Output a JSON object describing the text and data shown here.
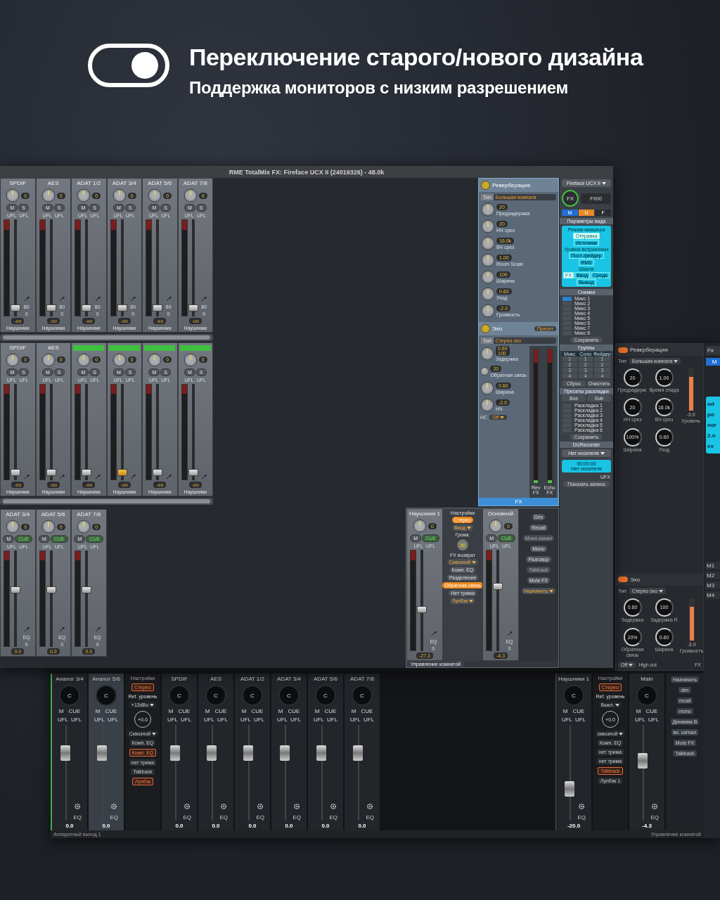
{
  "banner": {
    "switch_on": true,
    "title": "Переключение старого/нового дизайна",
    "subtitle": "Поддержка мониторов с низким разрешением"
  },
  "classic": {
    "title": "RME TotalMix FX: Fireface UCX II (24019326) - 48.0k",
    "rows": [
      {
        "strips": [
          {
            "name": "SPDIF",
            "gain": "0",
            "buttons": [
              "M",
              "S"
            ],
            "peaks": [
              "UFL",
              "UFL"
            ],
            "level": 0.05,
            "reading": "-oo",
            "route": "Наушники",
            "side": [
              "80",
              "0"
            ],
            "highlighted": false,
            "active": false
          },
          {
            "name": "AES",
            "gain": "0",
            "buttons": [
              "M",
              "S"
            ],
            "peaks": [
              "UFL",
              "UFL"
            ],
            "level": 0.05,
            "reading": "-oo",
            "route": "Наушники",
            "side": [
              "80",
              "0"
            ],
            "highlighted": false,
            "active": false
          },
          {
            "name": "ADAT 1/2",
            "gain": "0",
            "buttons": [
              "M",
              "S"
            ],
            "peaks": [
              "UFL",
              "UFL"
            ],
            "level": 0.05,
            "reading": "-oo",
            "route": "Наушники",
            "side": [
              "80",
              "0"
            ],
            "highlighted": false,
            "active": false
          },
          {
            "name": "ADAT 3/4",
            "gain": "0",
            "buttons": [
              "M",
              "S"
            ],
            "peaks": [
              "UFL",
              "UFL"
            ],
            "level": 0.05,
            "reading": "-oo",
            "route": "Наушники",
            "side": [
              "80",
              "0"
            ],
            "highlighted": false,
            "active": false
          },
          {
            "name": "ADAT 5/6",
            "gain": "0",
            "buttons": [
              "M",
              "S"
            ],
            "peaks": [
              "UFL",
              "UFL"
            ],
            "level": 0.05,
            "reading": "-oo",
            "route": "Наушники",
            "side": [
              "80",
              "0"
            ],
            "highlighted": false,
            "active": false
          },
          {
            "name": "ADAT 7/8",
            "gain": "0",
            "buttons": [
              "M",
              "S"
            ],
            "peaks": [
              "UFL",
              "UFL"
            ],
            "level": 0.05,
            "reading": "-oo",
            "route": "Наушники",
            "side": [
              "80",
              "0"
            ],
            "highlighted": false,
            "active": false
          }
        ]
      },
      {
        "strips": [
          {
            "name": "SPDIF",
            "gain": "0",
            "buttons": [
              "M",
              "S"
            ],
            "peaks": [
              "UFL",
              "UFL"
            ],
            "level": 0.05,
            "reading": "-oo",
            "route": "Наушники",
            "highlighted": false,
            "active": false
          },
          {
            "name": "AES",
            "gain": "0",
            "buttons": [
              "M",
              "S"
            ],
            "peaks": [
              "UFL",
              "UFL"
            ],
            "level": 0.05,
            "reading": "-oo",
            "route": "Наушники",
            "highlighted": false,
            "active": false
          },
          {
            "gain": "0",
            "buttons": [
              "M",
              "S"
            ],
            "peaks": [
              "UFL",
              "UFL"
            ],
            "level": 0.05,
            "reading": "-oo",
            "route": "Наушники",
            "highlighted": true,
            "active": false
          },
          {
            "gain": "0",
            "buttons": [
              "M",
              "S"
            ],
            "peaks": [
              "UFL",
              "UFL"
            ],
            "level": 0.05,
            "reading": "-oo",
            "route": "Наушники",
            "highlighted": true,
            "active": true
          },
          {
            "gain": "0",
            "buttons": [
              "M",
              "S"
            ],
            "peaks": [
              "UFL",
              "UFL"
            ],
            "level": 0.05,
            "reading": "-oo",
            "route": "Наушники",
            "highlighted": true,
            "active": false
          },
          {
            "gain": "0",
            "buttons": [
              "M",
              "S"
            ],
            "peaks": [
              "UFL",
              "UFL"
            ],
            "level": 0.05,
            "reading": "-oo",
            "route": "Наушники",
            "highlighted": true,
            "active": false
          }
        ]
      }
    ],
    "outputs": [
      {
        "name": "ADAT 3/4",
        "gain": "0",
        "buttons": [
          "M",
          "CUE"
        ],
        "cue_on": true,
        "peaks": [
          "UFL",
          "UFL"
        ],
        "level": 0.6,
        "reading": "0.0",
        "side": [
          "EQ",
          "0"
        ]
      },
      {
        "name": "ADAT 5/6",
        "gain": "0",
        "buttons": [
          "M",
          "CUE"
        ],
        "cue_on": true,
        "peaks": [
          "UFL",
          "UFL"
        ],
        "level": 0.6,
        "reading": "0.0",
        "side": [
          "EQ",
          "0"
        ]
      },
      {
        "name": "ADAT 7/8",
        "gain": "0",
        "buttons": [
          "M",
          "CUE"
        ],
        "cue_on": true,
        "peaks": [
          "UFL",
          "UFL"
        ],
        "level": 0.6,
        "reading": "0.0",
        "side": [
          "EQ",
          "0"
        ]
      }
    ],
    "reverb": {
      "title": "Реверберация",
      "type_label": "Тип",
      "type": "Большая комната",
      "knobs": [
        {
          "value": "20",
          "label": "Предзадержка"
        },
        {
          "value": "20",
          "label": "НЧ срез"
        },
        {
          "value": "16.0k",
          "label": "ВЧ срез"
        },
        {
          "value": "1.00",
          "label": "Room Scale"
        },
        {
          "value": "100",
          "label": "Ширина"
        },
        {
          "value": "0.60",
          "label": "Уход"
        },
        {
          "value": "-2.0",
          "label": "Громкость"
        }
      ]
    },
    "echo": {
      "title": "Эхо",
      "preset": "Пресет",
      "type_label": "Тип",
      "type": "Стерео эхо",
      "knobs": [
        {
          "value": "0.60",
          "value2": "100",
          "label": "Задержка"
        },
        {
          "value": "20",
          "label": "Обратная связь"
        },
        {
          "value": "0.60",
          "label": "Ширина"
        },
        {
          "value": "-2.0",
          "label": "НЧ"
        }
      ],
      "hc_label": "HC",
      "hc": "Off",
      "meters": [
        {
          "label": "Rev FX",
          "level": 0.02
        },
        {
          "label": "Echo FX",
          "level": 0.02
        }
      ],
      "footer": "FX"
    },
    "side": {
      "device": "Fireface UCX II",
      "fx": "FX",
      "fx_value": "FX00",
      "modes": [
        {
          "label": "M",
          "color": "#1f6fd6"
        },
        {
          "label": "H",
          "color": "#e8892a"
        },
        {
          "label": "F",
          "color": "#2a2d31"
        }
      ],
      "view_title": "Параметры вида",
      "view_sections": [
        {
          "heading": "Режим микшера",
          "buttons": [
            {
              "label": "Отправка",
              "selected": true
            },
            {
              "label": "Источник",
              "selected": false
            }
          ]
        },
        {
          "heading": "Уровни встроенных",
          "buttons": [
            {
              "label": "Пост-фейдер",
              "selected": false
            },
            {
              "label": "RMS",
              "selected": false
            }
          ]
        },
        {
          "heading": "Шкала",
          "buttons": [
            {
              "label": "FX",
              "selected": true
            },
            {
              "label": "Ввод",
              "selected": false
            },
            {
              "label": "Среда",
              "selected": false
            },
            {
              "label": "Вывод",
              "selected": false
            }
          ]
        }
      ],
      "snapshots_title": "Снимки",
      "snapshots": [
        {
          "label": "Микс 1",
          "selected": true
        },
        {
          "label": "Микс 2",
          "selected": false
        },
        {
          "label": "Микс 3",
          "selected": false
        },
        {
          "label": "Микс 4",
          "selected": false
        },
        {
          "label": "Микс 5",
          "selected": false
        },
        {
          "label": "Микс 6",
          "selected": false
        },
        {
          "label": "Микс 7",
          "selected": false
        },
        {
          "label": "Микс 8",
          "selected": false
        }
      ],
      "snapshots_save": "Сохранить",
      "groups_title": "Группы",
      "group_headers": [
        "Микс",
        "Соло",
        "Фейдер"
      ],
      "group_rows": [
        [
          "1",
          "1",
          "1"
        ],
        [
          "2",
          "2",
          "2"
        ],
        [
          "3",
          "3",
          "3"
        ],
        [
          "4",
          "4",
          "4"
        ]
      ],
      "group_buttons": [
        "Сброс",
        "Очистить"
      ],
      "layouts_title": "Пресеты раскладки",
      "layout_buttons": [
        "Все",
        "Sub"
      ],
      "layouts": [
        "Раскладка 1",
        "Раскладка 2",
        "Раскладка 3",
        "Раскладка 4",
        "Раскладка 5",
        "Раскладка 6"
      ],
      "layouts_save": "Сохранить",
      "recorder_title": "DURecorder",
      "recorder_media": "Нет носителя",
      "recorder_time": "00:00:00",
      "recorder_status": "Нет носителя",
      "recorder_tag": "UFX",
      "recorder_show": "Показать запись"
    },
    "room": {
      "footer": "Управление комнатой",
      "left": {
        "name": "Наушники 1",
        "gain": "0",
        "buttons": [
          "M",
          "CUE"
        ],
        "cue_on": true,
        "peaks": [
          "UFL",
          "UFL"
        ],
        "level": 0.4,
        "reading": "-27.3",
        "side": [
          "EQ",
          "0"
        ]
      },
      "settings": {
        "title": "Настройки",
        "items": [
          {
            "kind": "accent",
            "text": "Стерео"
          },
          {
            "kind": "select",
            "text": "Вход"
          },
          {
            "kind": "label",
            "text": "Громк."
          },
          {
            "kind": "knob",
            "text": "30"
          },
          {
            "kind": "label",
            "text": "FX возврат"
          },
          {
            "kind": "select",
            "text": "Сквозной"
          },
          {
            "kind": "button",
            "text": "Комп. EQ"
          },
          {
            "kind": "button",
            "text": "Разделение"
          },
          {
            "kind": "accent",
            "text": "Обратная связь"
          },
          {
            "kind": "button",
            "text": "Нет трима"
          },
          {
            "kind": "select",
            "text": "Лупбэк"
          }
        ]
      },
      "right": {
        "name": "Основной",
        "gain": "0",
        "buttons": [
          "M",
          "CUE"
        ],
        "cue_on": true,
        "peaks": [
          "UFL",
          "UFL"
        ],
        "level": 0.65,
        "reading": "-4.3",
        "side": [
          "EQ",
          "0"
        ]
      },
      "controls": [
        {
          "kind": "button",
          "text": "Dim"
        },
        {
          "kind": "button",
          "text": "Recall"
        },
        {
          "kind": "disabled",
          "text": "Моно канал"
        },
        {
          "kind": "button",
          "text": "Mono"
        },
        {
          "kind": "button",
          "text": "Разговор"
        },
        {
          "kind": "disabled",
          "text": "Talkback"
        },
        {
          "kind": "button",
          "text": "Mute FX"
        },
        {
          "kind": "select",
          "text": "Назначить"
        }
      ]
    }
  },
  "modern": {
    "reverb": {
      "title": "Реверберация",
      "on": true,
      "type_label": "Тип",
      "type": "Большая комната",
      "knobs": [
        {
          "value": "20",
          "label": "Предзадерж."
        },
        {
          "value": "1.00",
          "label": "Время спада"
        },
        {
          "value": "20",
          "label": "НЧ срез"
        },
        {
          "value": "18.0k",
          "label": "ВЧ срез"
        },
        {
          "value": "100%",
          "label": "Ширина"
        },
        {
          "value": "0.60",
          "label": "Уход"
        }
      ],
      "fader_value": "-3.0",
      "fader_label": "Уровень",
      "level": 0.8
    },
    "echo": {
      "title": "Эхо",
      "on": true,
      "type_label": "Тип",
      "type": "Стерео эхо",
      "knobs": [
        {
          "value": "0.60",
          "label": "Задержка"
        },
        {
          "value": "100",
          "label": "Задержка R"
        },
        {
          "value": "20%",
          "label": "Обратная связь"
        },
        {
          "value": "0.60",
          "label": "Ширина"
        }
      ],
      "fader_value": "-3.0",
      "fader_label": "Громкость",
      "level": 0.8,
      "hc": "Off",
      "hc_label": "High cut",
      "meter_label": "FX"
    },
    "edge": {
      "device": "Fir",
      "mode": "M",
      "texts": [
        "od",
        "po",
        "nor",
        "2.n",
        "ex"
      ],
      "mixes": [
        "M1",
        "M2",
        "M3",
        "M4"
      ]
    },
    "strips": [
      {
        "name": "Аналог 3/4",
        "pan": "C",
        "buttons": [
          "M",
          "CUE"
        ],
        "peaks": [
          "UFL",
          "UFL"
        ],
        "level": 0.75,
        "eq": "EQ",
        "reading": "0.0",
        "selected": false
      },
      {
        "name": "Аналог 5/6",
        "pan": "C",
        "buttons": [
          "M",
          "CUE"
        ],
        "peaks": [
          "UFL",
          "UFL"
        ],
        "level": 0.75,
        "eq": "EQ",
        "reading": "0.0",
        "selected": true
      },
      {
        "name": "SPDIF",
        "pan": "C",
        "buttons": [
          "M",
          "CUE"
        ],
        "peaks": [
          "UFL",
          "UFL"
        ],
        "level": 0.75,
        "eq": "EQ",
        "reading": "0.0",
        "selected": false
      },
      {
        "name": "AES",
        "pan": "C",
        "buttons": [
          "M",
          "CUE"
        ],
        "peaks": [
          "UFL",
          "UFL"
        ],
        "level": 0.75,
        "eq": "EQ",
        "reading": "0.0",
        "selected": false
      },
      {
        "name": "ADAT 1/2",
        "pan": "C",
        "buttons": [
          "M",
          "CUE"
        ],
        "peaks": [
          "UFL",
          "UFL"
        ],
        "level": 0.75,
        "eq": "EQ",
        "reading": "0.0",
        "selected": false
      },
      {
        "name": "ADAT 3/4",
        "pan": "C",
        "buttons": [
          "M",
          "CUE"
        ],
        "peaks": [
          "UFL",
          "UFL"
        ],
        "level": 0.75,
        "eq": "EQ",
        "reading": "0.0",
        "selected": false
      },
      {
        "name": "ADAT 5/6",
        "pan": "C",
        "buttons": [
          "M",
          "CUE"
        ],
        "peaks": [
          "UFL",
          "UFL"
        ],
        "level": 0.75,
        "eq": "EQ",
        "reading": "0.0",
        "selected": false
      },
      {
        "name": "ADAT 7/8",
        "pan": "C",
        "buttons": [
          "M",
          "CUE"
        ],
        "peaks": [
          "UFL",
          "UFL"
        ],
        "level": 0.75,
        "eq": "EQ",
        "reading": "0.0",
        "selected": false
      }
    ],
    "settings": {
      "title": "Настройки",
      "items": [
        {
          "kind": "accent",
          "text": "Стерео"
        },
        {
          "kind": "label",
          "text": "Ref. уровень"
        },
        {
          "kind": "select",
          "text": "+13dBu"
        },
        {
          "kind": "knob",
          "text": "+0.0"
        },
        {
          "kind": "select",
          "text": "Сквозной"
        },
        {
          "kind": "button",
          "text": "Комп. EQ"
        },
        {
          "kind": "accent",
          "text": "Комп. EQ"
        },
        {
          "kind": "button",
          "text": "нет трима"
        },
        {
          "kind": "button",
          "text": "Talkback"
        },
        {
          "kind": "accent",
          "text": "Лупбэк"
        }
      ]
    },
    "footer": "Аппаратный выход 1",
    "room": {
      "left": {
        "name": "Наушники 1",
        "pan": "C",
        "buttons": [
          "M",
          "CUE"
        ],
        "peaks": [
          "UFL",
          "UFL"
        ],
        "level": 0.3,
        "eq": "EQ",
        "reading": "-20.0",
        "selected": false
      },
      "settings": {
        "title": "Настройки",
        "items": [
          {
            "kind": "accent",
            "text": "Стерео"
          },
          {
            "kind": "label",
            "text": "Ref. уровень"
          },
          {
            "kind": "select",
            "text": "Выкл."
          },
          {
            "kind": "knob",
            "text": "+0.0"
          },
          {
            "kind": "select",
            "text": "сквозной"
          },
          {
            "kind": "button",
            "text": "Комп. EQ"
          },
          {
            "kind": "button",
            "text": "нет трима"
          },
          {
            "kind": "button",
            "text": "нет трима"
          },
          {
            "kind": "accent",
            "text": "Talkback"
          },
          {
            "kind": "button",
            "text": "Лупбэк 1"
          }
        ]
      },
      "right": {
        "name": "Main",
        "pan": "C",
        "buttons": [
          "M",
          "CUE"
        ],
        "peaks": [
          "UFL",
          "UFL"
        ],
        "level": 0.65,
        "eq": "EQ",
        "reading": "-4.3",
        "selected": false
      },
      "controls": [
        {
          "kind": "button",
          "text": "Назначить"
        },
        {
          "kind": "button",
          "text": "dim"
        },
        {
          "kind": "button",
          "text": "recall"
        },
        {
          "kind": "button",
          "text": "mono"
        },
        {
          "kind": "button",
          "text": "Динамик B"
        },
        {
          "kind": "button",
          "text": "вх. сигнал"
        },
        {
          "kind": "button",
          "text": "Mute FX"
        },
        {
          "kind": "button",
          "text": "Talkback"
        }
      ],
      "footer": "Управление комнатой"
    }
  }
}
